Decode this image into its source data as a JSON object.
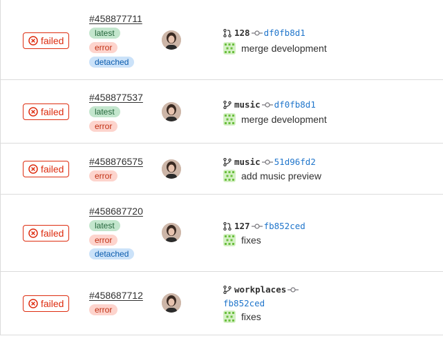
{
  "pipelines": [
    {
      "status": "failed",
      "id": "#458877711",
      "badges": [
        "latest",
        "error",
        "detached"
      ],
      "ref_type": "merge-request",
      "ref": "128",
      "sha": "df0fb8d1",
      "message": "merge development"
    },
    {
      "status": "failed",
      "id": "#458877537",
      "badges": [
        "latest",
        "error"
      ],
      "ref_type": "branch",
      "ref": "music",
      "sha": "df0fb8d1",
      "message": "merge development"
    },
    {
      "status": "failed",
      "id": "#458876575",
      "badges": [
        "error"
      ],
      "ref_type": "branch",
      "ref": "music",
      "sha": "51d96fd2",
      "message": "add music preview"
    },
    {
      "status": "failed",
      "id": "#458687720",
      "badges": [
        "latest",
        "error",
        "detached"
      ],
      "ref_type": "merge-request",
      "ref": "127",
      "sha": "fb852ced",
      "message": "fixes"
    },
    {
      "status": "failed",
      "id": "#458687712",
      "badges": [
        "error"
      ],
      "ref_type": "branch",
      "ref": "workplaces",
      "sha": "fb852ced",
      "message": "fixes"
    }
  ],
  "colors": {
    "failed": "#dd2b0e",
    "sha": "#1f75cb"
  }
}
